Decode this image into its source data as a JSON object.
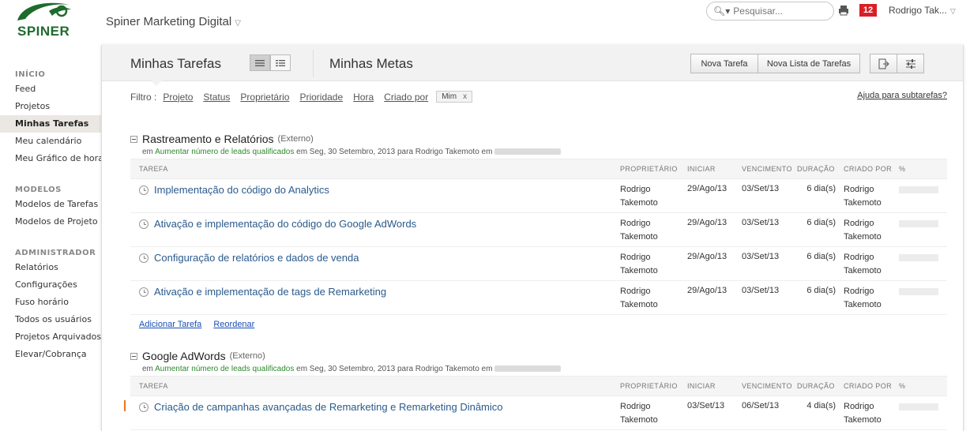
{
  "header": {
    "logo_text": "SPINER",
    "company": "Spiner Marketing Digital",
    "search_placeholder": "Pesquisar...",
    "notification_count": "12",
    "user_name": "Rodrigo Tak..."
  },
  "sidebar": {
    "sections": [
      {
        "title": "INÍCIO",
        "items": [
          "Feed",
          "Projetos",
          "Minhas Tarefas",
          "Meu calendário",
          "Meu Gráfico de horas"
        ]
      },
      {
        "title": "MODELOS",
        "items": [
          "Modelos de Tarefas",
          "Modelos de Projeto"
        ]
      },
      {
        "title": "ADMINISTRADOR",
        "items": [
          "Relatórios",
          "Configurações",
          "Fuso horário",
          "Todos os usuários",
          "Projetos Arquivados",
          "Elevar/Cobrança"
        ]
      }
    ],
    "active": "Minhas Tarefas"
  },
  "panel": {
    "title_tasks": "Minhas Tarefas",
    "title_goals": "Minhas Metas",
    "btn_new_task": "Nova Tarefa",
    "btn_new_list": "Nova Lista de Tarefas"
  },
  "filter": {
    "label": "Filtro :",
    "links": [
      "Projeto",
      "Status",
      "Proprietário",
      "Prioridade",
      "Hora",
      "Criado por"
    ],
    "chip": "Mim",
    "chip_close": "x",
    "help": "Ajuda para subtarefas?"
  },
  "columns": {
    "task": "TAREFA",
    "owner": "PROPRIETÁRIO",
    "start": "INICIAR",
    "due": "VENCIMENTO",
    "duration": "DURAÇÃO",
    "created_by": "CRIADO POR",
    "pct": "%"
  },
  "projects": [
    {
      "name": "Rastreamento e Relatórios",
      "tag": "(Externo)",
      "meta_prefix": "em",
      "meta_goal": "Aumentar número de leads qualificados",
      "meta_suffix": "em Seg, 30 Setembro, 2013 para Rodrigo Takemoto em",
      "tasks": [
        {
          "name": "Implementação do código do Analytics",
          "owner_first": "Rodrigo",
          "owner_last": "Takemoto",
          "start": "29/Ago/13",
          "due": "03/Set/13",
          "duration": "6 dia(s)",
          "by_first": "Rodrigo",
          "by_last": "Takemoto"
        },
        {
          "name": "Ativação e implementação do código do Google AdWords",
          "owner_first": "Rodrigo",
          "owner_last": "Takemoto",
          "start": "29/Ago/13",
          "due": "03/Set/13",
          "duration": "6 dia(s)",
          "by_first": "Rodrigo",
          "by_last": "Takemoto"
        },
        {
          "name": "Configuração de relatórios e dados de venda",
          "owner_first": "Rodrigo",
          "owner_last": "Takemoto",
          "start": "29/Ago/13",
          "due": "03/Set/13",
          "duration": "6 dia(s)",
          "by_first": "Rodrigo",
          "by_last": "Takemoto"
        },
        {
          "name": "Ativação e implementação de tags de Remarketing",
          "owner_first": "Rodrigo",
          "owner_last": "Takemoto",
          "start": "29/Ago/13",
          "due": "03/Set/13",
          "duration": "6 dia(s)",
          "by_first": "Rodrigo",
          "by_last": "Takemoto"
        }
      ],
      "add_task": "Adicionar Tarefa",
      "reorder": "Reordenar"
    },
    {
      "name": "Google AdWords",
      "tag": "(Externo)",
      "meta_prefix": "em",
      "meta_goal": "Aumentar número de leads qualificados",
      "meta_suffix": "em Seg, 30 Setembro, 2013 para Rodrigo Takemoto em",
      "tasks": [
        {
          "name": "Criação de campanhas avançadas de Remarketing e Remarketing Dinâmico",
          "owner_first": "Rodrigo",
          "owner_last": "Takemoto",
          "start": "03/Set/13",
          "due": "06/Set/13",
          "duration": "4 dia(s)",
          "by_first": "Rodrigo",
          "by_last": "Takemoto"
        }
      ]
    }
  ]
}
